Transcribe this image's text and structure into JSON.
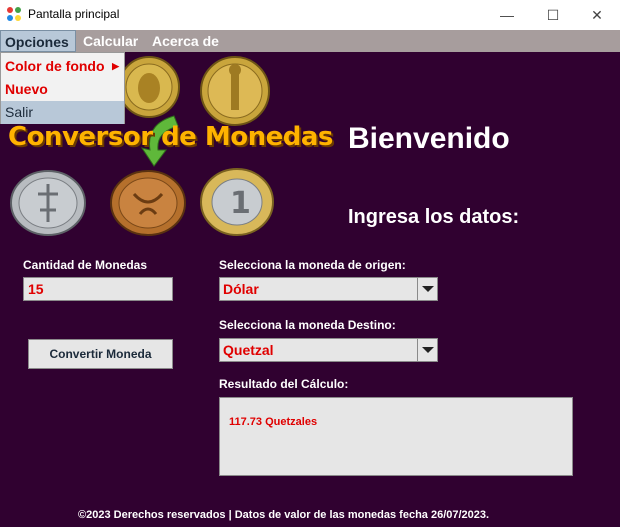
{
  "window": {
    "title": "Pantalla principal",
    "minimize_glyph": "—",
    "maximize_glyph": "☐",
    "close_glyph": "✕"
  },
  "menubar": {
    "items": [
      {
        "label": "Opciones"
      },
      {
        "label": "Calcular"
      },
      {
        "label": "Acerca de"
      }
    ]
  },
  "dropdown": {
    "items": [
      {
        "label": "Color de fondo",
        "submenu_arrow": "▶"
      },
      {
        "label": "Nuevo"
      },
      {
        "label": "Salir"
      }
    ]
  },
  "header": {
    "brand": "Conversor de Monedas",
    "welcome": "Bienvenido",
    "prompt": "Ingresa los datos:"
  },
  "form": {
    "amount_label": "Cantidad de Monedas",
    "amount_value": "15",
    "origin_label": "Selecciona la moneda de origen:",
    "origin_value": "Dólar",
    "destination_label": "Selecciona la moneda Destino:",
    "destination_value": "Quetzal",
    "convert_button": "Convertir Moneda",
    "result_label": "Resultado del Cálculo:",
    "result_value": "117.73 Quetzales"
  },
  "footer": {
    "text": "©2023 Derechos reservados | Datos de valor de las monedas fecha 26/07/2023."
  },
  "colors": {
    "background": "#300130",
    "accent_text": "#e00000",
    "brand_title": "#ffb300",
    "menubar": "#a79d9d"
  }
}
